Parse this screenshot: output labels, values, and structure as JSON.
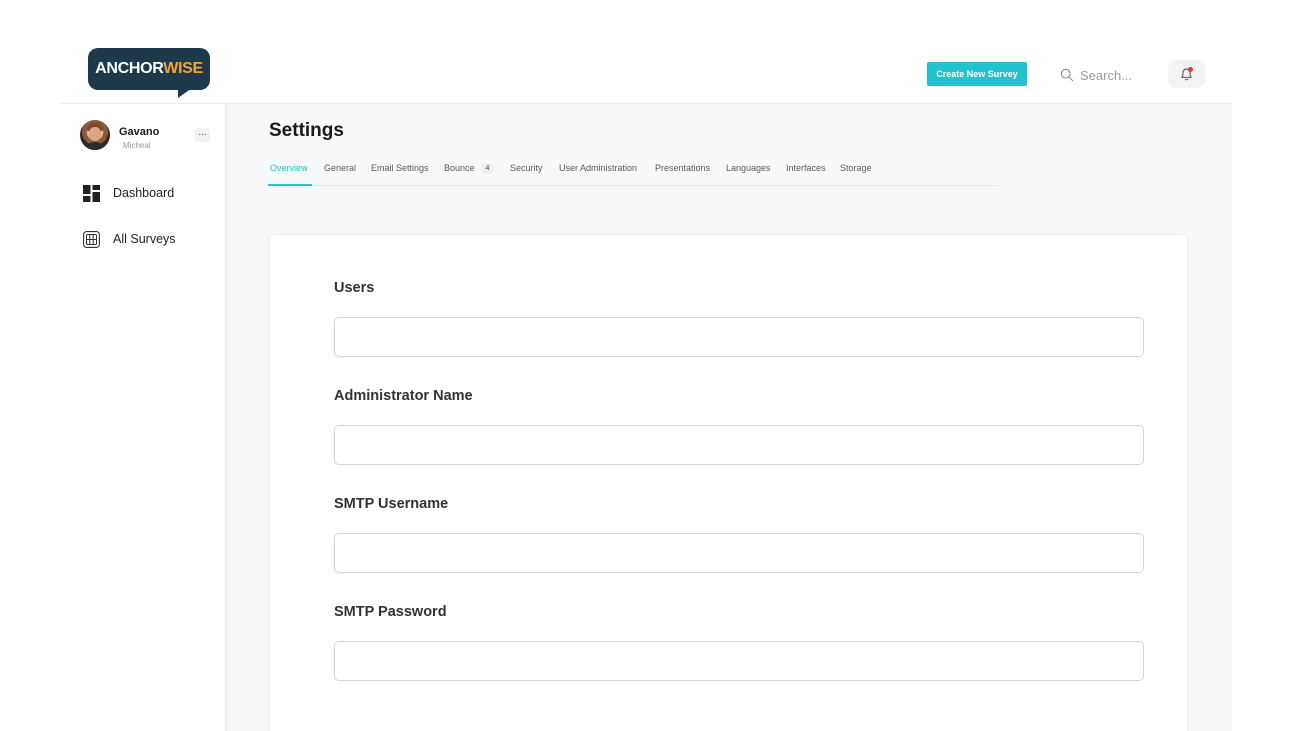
{
  "brand": {
    "logo_main": "ANCHOR",
    "logo_accent": "WISE",
    "accent_color": "#22c3cf",
    "logo_bg": "#1e3a4a",
    "logo_accent_color": "#f0a23a"
  },
  "header": {
    "create_label": "Create New Survey",
    "search_placeholder": "Search...",
    "bell_icon": "bell-icon",
    "notification_dot_color": "#e53935"
  },
  "sidebar": {
    "user": {
      "name": "Gavano",
      "subtitle": "Micheal"
    },
    "more_label": "...",
    "items": [
      {
        "label": "Dashboard",
        "icon": "dashboard-icon"
      },
      {
        "label": "All Surveys",
        "icon": "surveys-icon"
      }
    ]
  },
  "page": {
    "title": "Settings",
    "tabs": [
      {
        "label": "Overview",
        "active": true
      },
      {
        "label": "General"
      },
      {
        "label": "Email Settings"
      },
      {
        "label": "Bounce",
        "badge": "4"
      },
      {
        "label": "Security"
      },
      {
        "label": "User Administration"
      },
      {
        "label": "Presentations"
      },
      {
        "label": "Languages"
      },
      {
        "label": "Interfaces"
      },
      {
        "label": "Storage"
      }
    ]
  },
  "form": {
    "fields": [
      {
        "label": "Users",
        "value": ""
      },
      {
        "label": "Administrator Name",
        "value": ""
      },
      {
        "label": "SMTP Username",
        "value": ""
      },
      {
        "label": "SMTP Password",
        "value": ""
      }
    ]
  }
}
